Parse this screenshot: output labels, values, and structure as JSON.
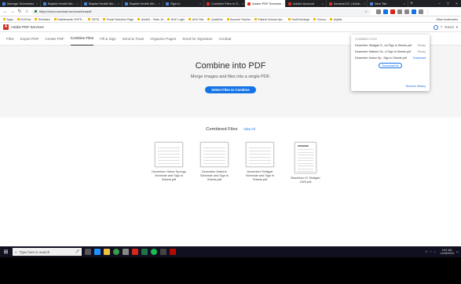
{
  "browser": {
    "tabs": [
      {
        "title": "Manage Schedules",
        "active": false,
        "icon": "blue"
      },
      {
        "title": "Baptist Health Me...",
        "active": false,
        "icon": "blue"
      },
      {
        "title": "Baptist Health Me...",
        "active": false,
        "icon": "blue"
      },
      {
        "title": "Baptist Health Me...",
        "active": false,
        "icon": "blue"
      },
      {
        "title": "Sign In",
        "active": false,
        "icon": "blue"
      },
      {
        "title": "Combine Files in O...",
        "active": false,
        "icon": "red"
      },
      {
        "title": "Adobe PDF Services",
        "active": true,
        "icon": "red"
      },
      {
        "title": "Adobe Account",
        "active": false,
        "icon": "red"
      },
      {
        "title": "Acrobat DC | Adob...",
        "active": false,
        "icon": "red"
      },
      {
        "title": "New Tab",
        "active": false,
        "icon": "blue"
      }
    ],
    "url": "https://cloud.acrobat.com/combinepdf",
    "bookmarks": [
      "Apps",
      "EmTime",
      "EmNotes",
      "Dashboards: EVPS...",
      "OETA",
      "Portal Selection Page",
      "Area51 - Team 15",
      "AHC Login",
      "AHC Site",
      "Quicklink",
      "Account Tracker",
      "Patient Volume Apr...",
      "OneExchange",
      "Concur",
      "Anjalis"
    ],
    "other_bookmarks": "Other bookmarks",
    "colors": {
      "accent": "#1473e6",
      "acrobat_red": "#d6271d"
    }
  },
  "app": {
    "title": "Adobe PDF Services",
    "user": "David",
    "menu": [
      "Files",
      "Export PDF",
      "Create PDF",
      "Combine Files",
      "Fill & Sign",
      "Send & Track",
      "Organize Pages",
      "Send for Signature",
      "Acrobat"
    ],
    "active_menu": "Combine Files"
  },
  "hero": {
    "title": "Combine into PDF",
    "subtitle": "Merge images and files into a single PDF.",
    "button": "Select Files to Combine"
  },
  "combined": {
    "heading": "Combined Files",
    "view_all": "View All",
    "files": [
      {
        "name_lines": [
          "December Holton Springs",
          "Schedule and Sign In",
          "Sheets.pdf"
        ]
      },
      {
        "name_lines": [
          "December Malvern",
          "Schedule and Sign In",
          "Sheets.pdf"
        ]
      },
      {
        "name_lines": [
          "December Stuttgart",
          "Schedule and Sign In",
          "Sheets.pdf"
        ]
      },
      {
        "name_lines": [
          "Blackburn IC Stuttgart",
          "1620.pdf"
        ]
      }
    ]
  },
  "popup": {
    "heading": "COMBINED FILES",
    "rows": [
      {
        "name": "December Stuttgart S...nd Sign In Sheets.pdf",
        "status": "Ready"
      },
      {
        "name": "December Malvern Sc...d Sign In Sheets.pdf",
        "status": "Ready"
      },
      {
        "name": "December Holton Sp...Sign In Sheets.pdf",
        "status": "Download"
      }
    ],
    "download_all": "Download All",
    "remove_history": "Remove History"
  },
  "taskbar": {
    "search_placeholder": "Type here to search",
    "time": "9:57 AM",
    "date": "11/28/2018"
  }
}
